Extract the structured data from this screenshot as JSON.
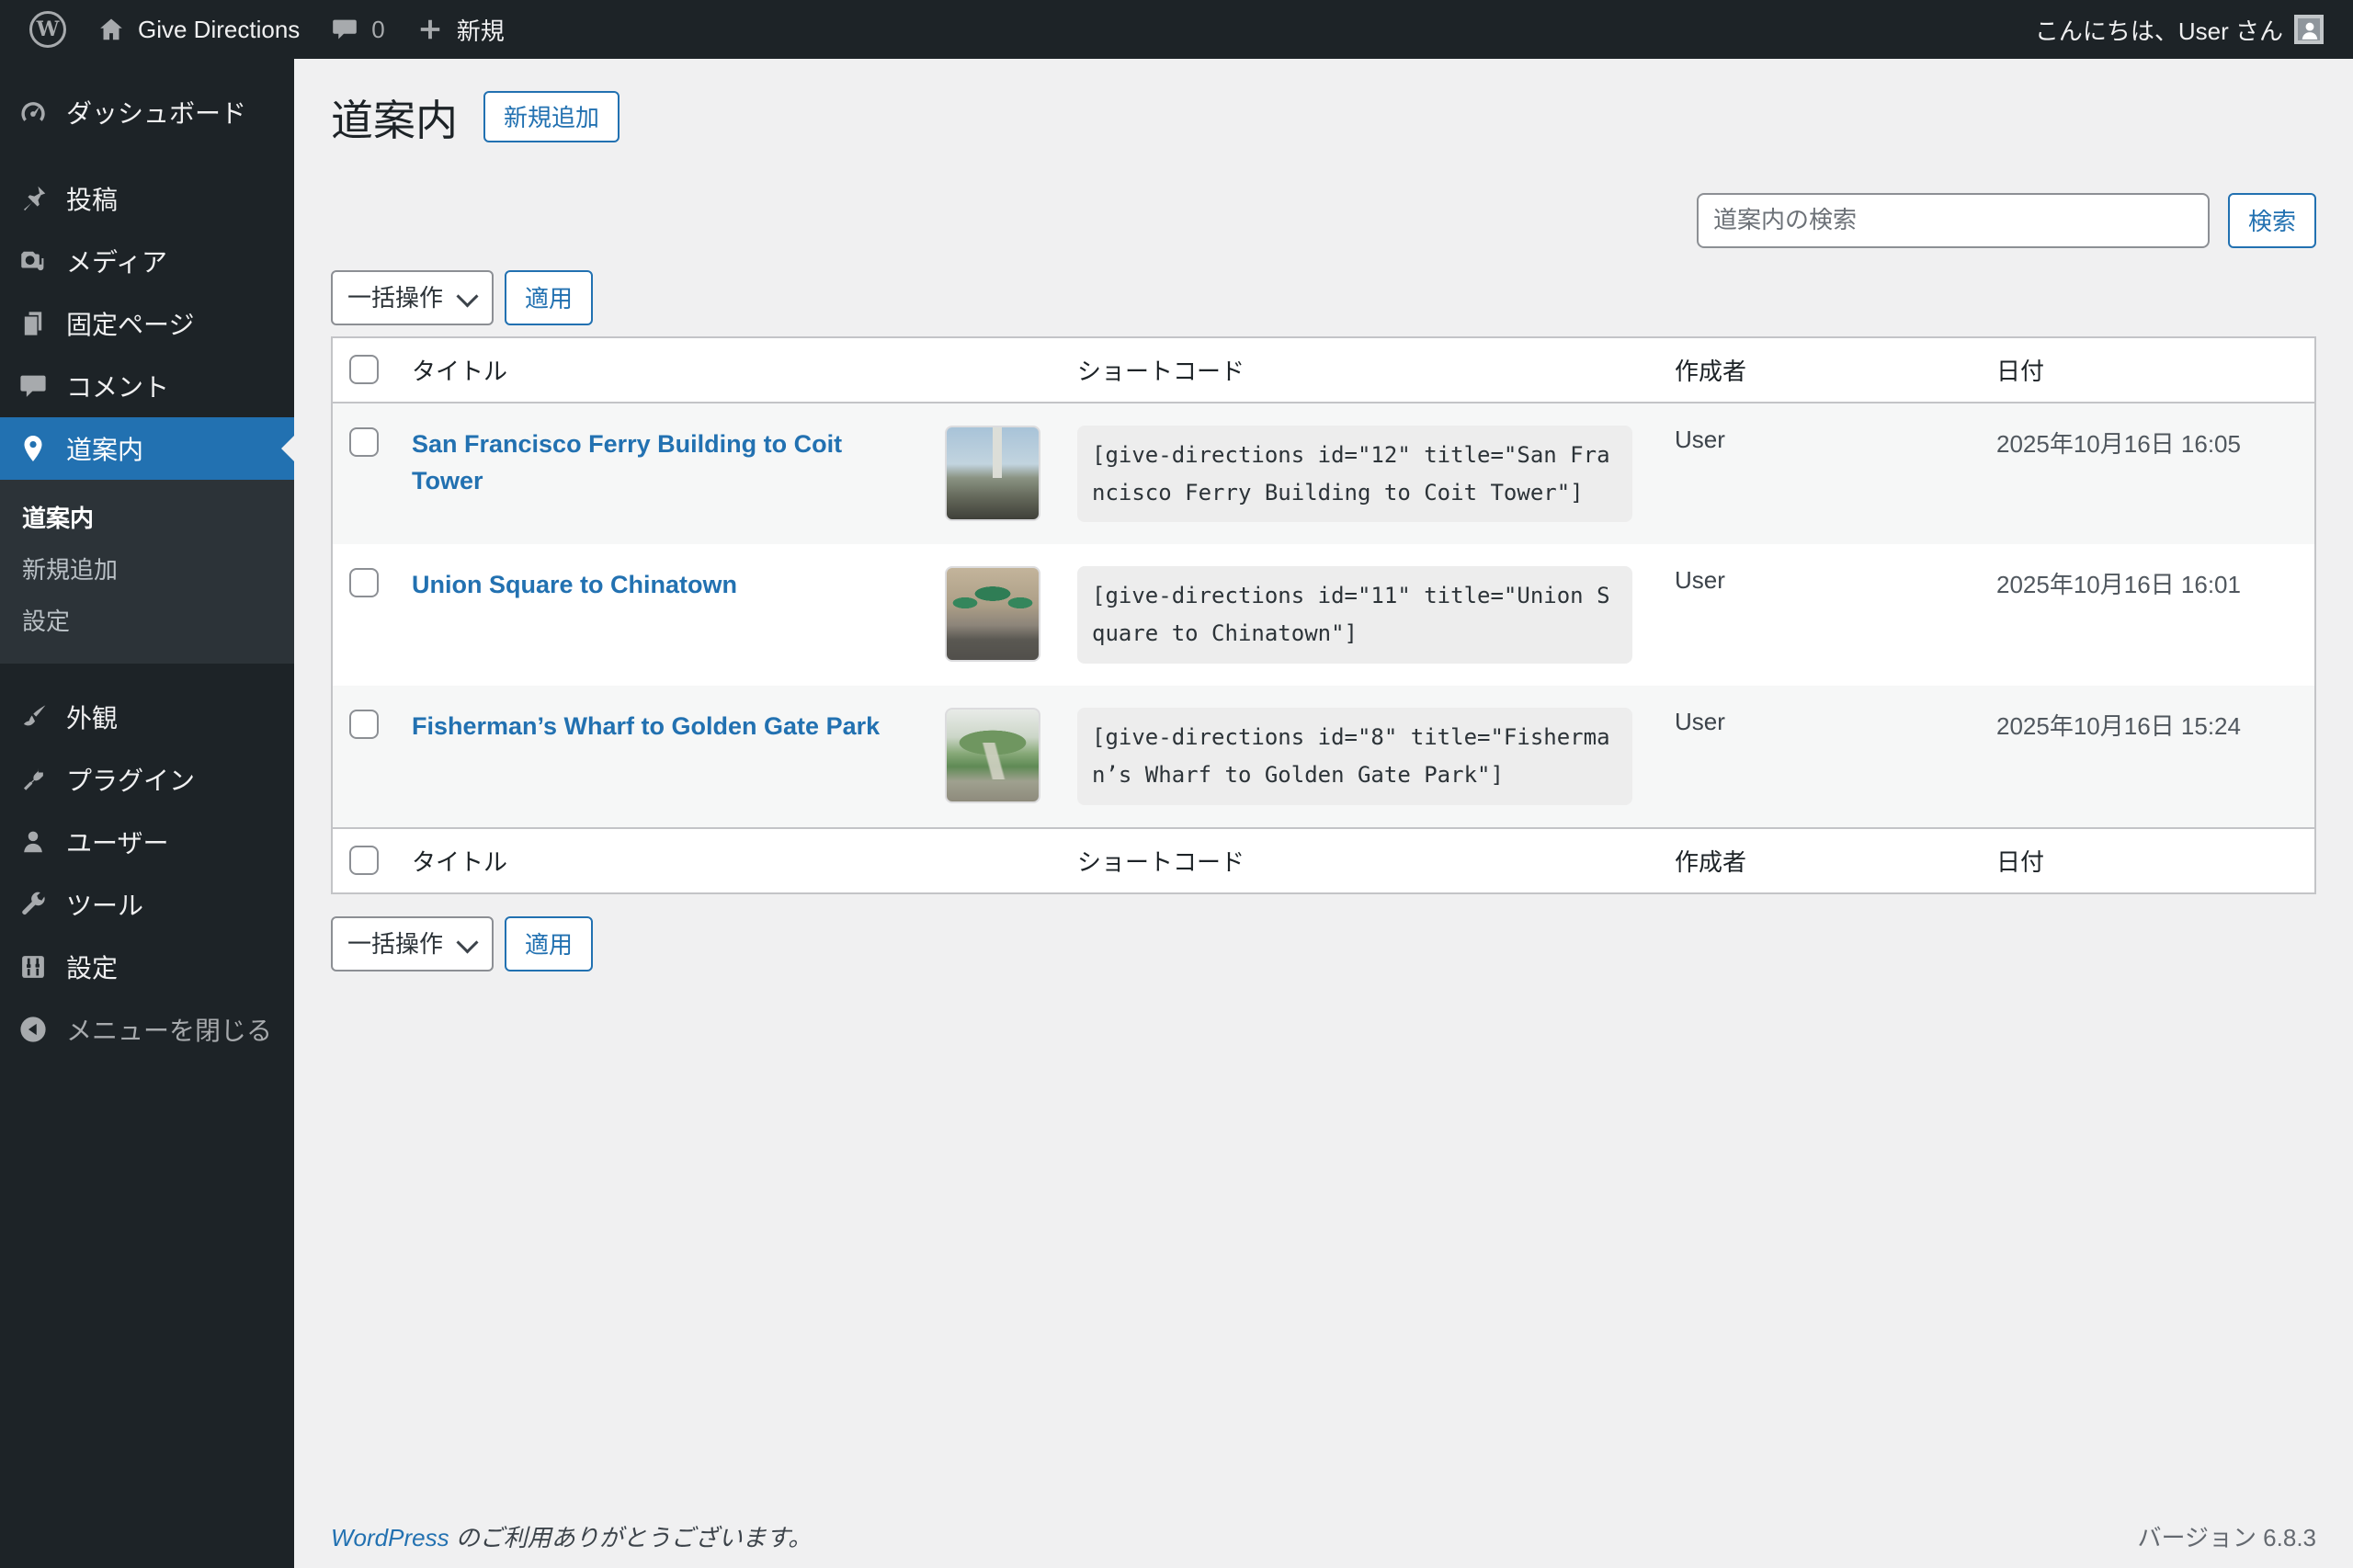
{
  "admin_bar": {
    "site_name": "Give Directions",
    "comment_count": "0",
    "new_label": "新規",
    "greeting": "こんにちは、User さん"
  },
  "sidebar": {
    "items": [
      {
        "label": "ダッシュボード"
      },
      {
        "label": "投稿"
      },
      {
        "label": "メディア"
      },
      {
        "label": "固定ページ"
      },
      {
        "label": "コメント"
      },
      {
        "label": "道案内",
        "active": true
      },
      {
        "label": "外観"
      },
      {
        "label": "プラグイン"
      },
      {
        "label": "ユーザー"
      },
      {
        "label": "ツール"
      },
      {
        "label": "設定"
      },
      {
        "label": "メニューを閉じる"
      }
    ],
    "submenu": [
      "道案内",
      "新規追加",
      "設定"
    ]
  },
  "page": {
    "title": "道案内",
    "add_new": "新規追加",
    "search_placeholder": "道案内の検索",
    "search_button": "検索",
    "bulk_action": "一括操作",
    "apply": "適用"
  },
  "table": {
    "headers": {
      "title": "タイトル",
      "shortcode": "ショートコード",
      "author": "作成者",
      "date": "日付"
    },
    "rows": [
      {
        "title": "San Francisco Ferry Building to Coit Tower",
        "shortcode": "[give-directions id=\"12\" title=\"San Francisco Ferry Building to Coit Tower\"]",
        "author": "User",
        "date": "2025年10月16日 16:05"
      },
      {
        "title": "Union Square to Chinatown",
        "shortcode": "[give-directions id=\"11\" title=\"Union Square to Chinatown\"]",
        "author": "User",
        "date": "2025年10月16日 16:01"
      },
      {
        "title": "Fisherman’s Wharf to Golden Gate Park",
        "shortcode": "[give-directions id=\"8\" title=\"Fisherman’s Wharf to Golden Gate Park\"]",
        "author": "User",
        "date": "2025年10月16日 15:24"
      }
    ]
  },
  "footer": {
    "thanks_link": "WordPress",
    "thanks_text": " のご利用ありがとうございます。",
    "version": "バージョン 6.8.3"
  },
  "colors": {
    "accent": "#2271b1",
    "admin_bar_bg": "#1d2327",
    "submenu_bg": "#2c3338",
    "body_bg": "#f0f0f1",
    "border": "#c3c4c7",
    "striped_row": "#f6f7f7"
  }
}
